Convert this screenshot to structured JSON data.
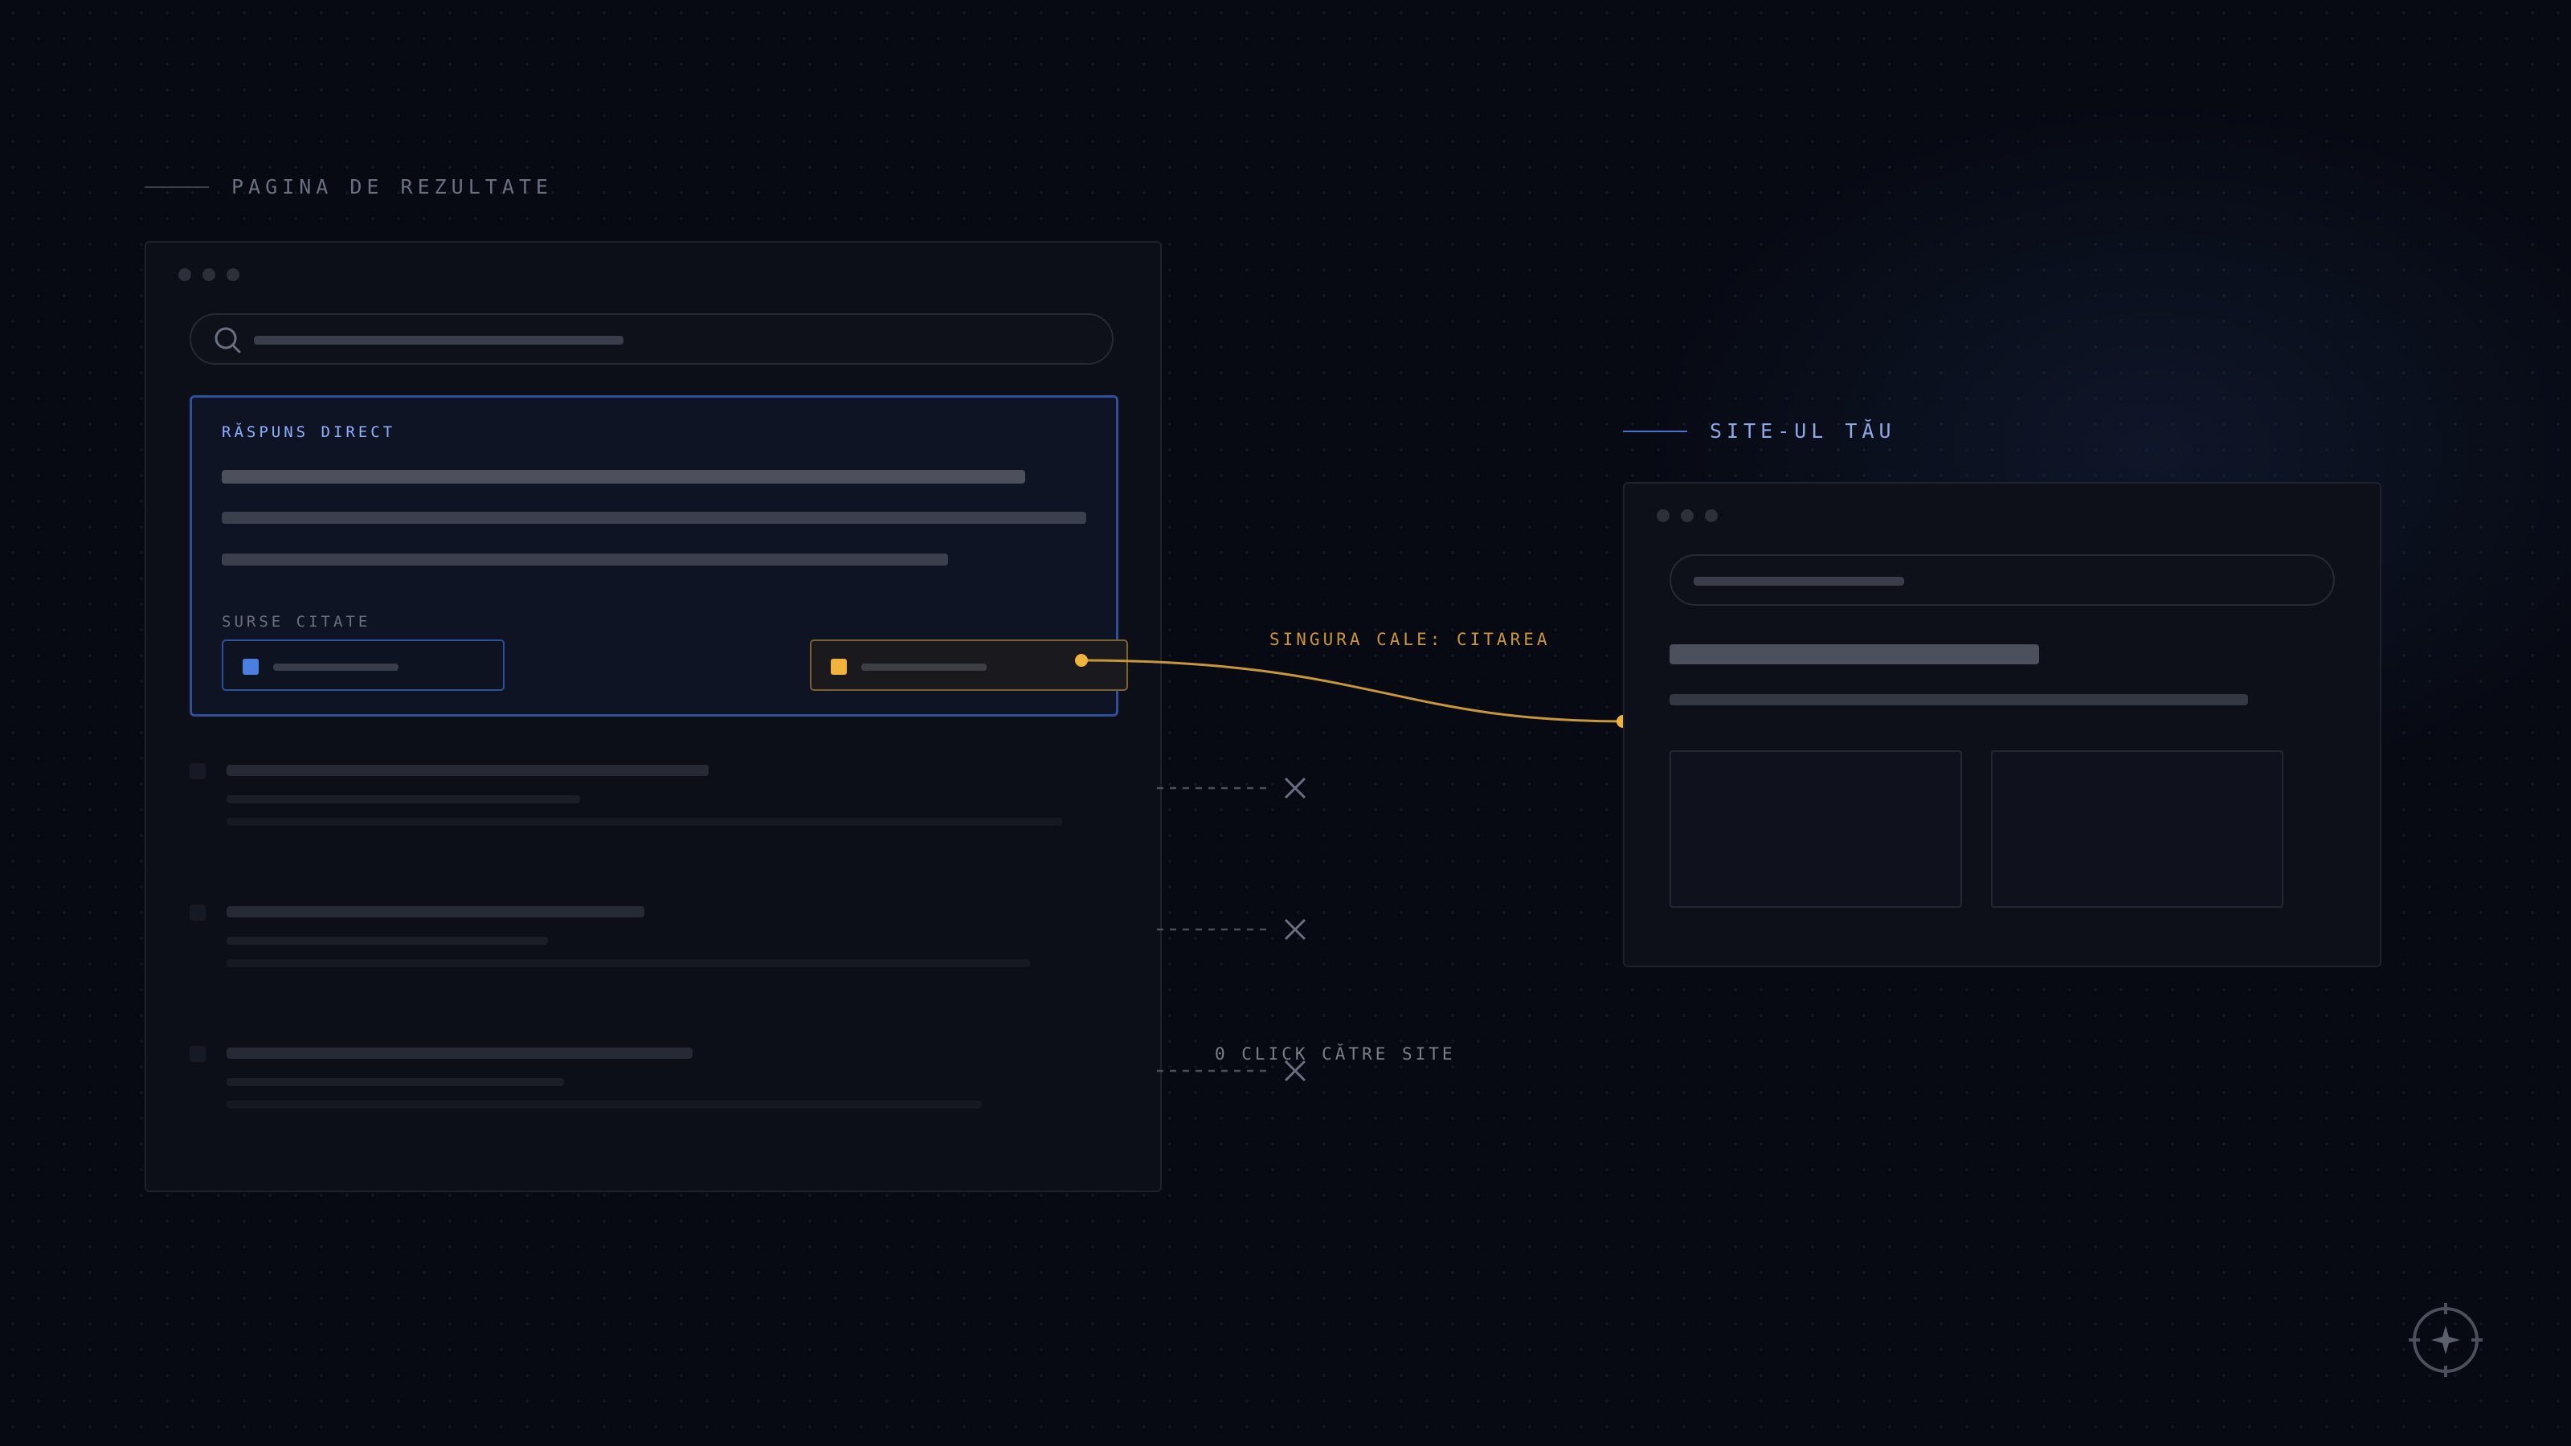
{
  "labels": {
    "results_page": "PAGINA DE REZULTATE",
    "your_site": "SITE-UL TĂU",
    "direct_answer": "RĂSPUNS DIRECT",
    "cited_sources": "SURSE CITATE",
    "only_path": "SINGURA CALE: CITAREA",
    "zero_clicks": "0 CLICK CĂTRE SITE"
  },
  "icons": {
    "search": "search-icon",
    "close": "close-icon",
    "compass": "compass-icon"
  },
  "colors": {
    "accent_blue": "#4a7fe0",
    "accent_amber": "#f0b43c",
    "label_muted": "#6a7080",
    "label_blue": "#8fa8e6",
    "answer_border": "#2f4f9a"
  }
}
